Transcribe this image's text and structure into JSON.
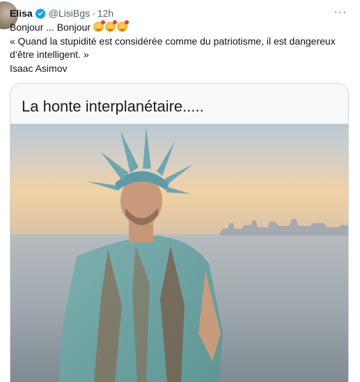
{
  "tweet": {
    "name": "Elisa",
    "handle": "@LisiBgs",
    "separator": "·",
    "time": "12h",
    "more": "···",
    "lines": [
      "Bonjour ... Bonjour",
      "« Quand la stupidité est considérée comme du patriotisme, il est dangereux",
      "d’être intelligent. »",
      "Isaac Asimov"
    ],
    "emoji_icons": [
      "smiling-face-with-hearts-icon",
      "smiling-face-with-hearts-icon",
      "face-blowing-kiss-icon"
    ],
    "verified_color": "#1d9bf0"
  },
  "media": {
    "title": "La honte interplanétaire.....",
    "alt_subject": "man-in-statue-of-liberty-costume"
  }
}
